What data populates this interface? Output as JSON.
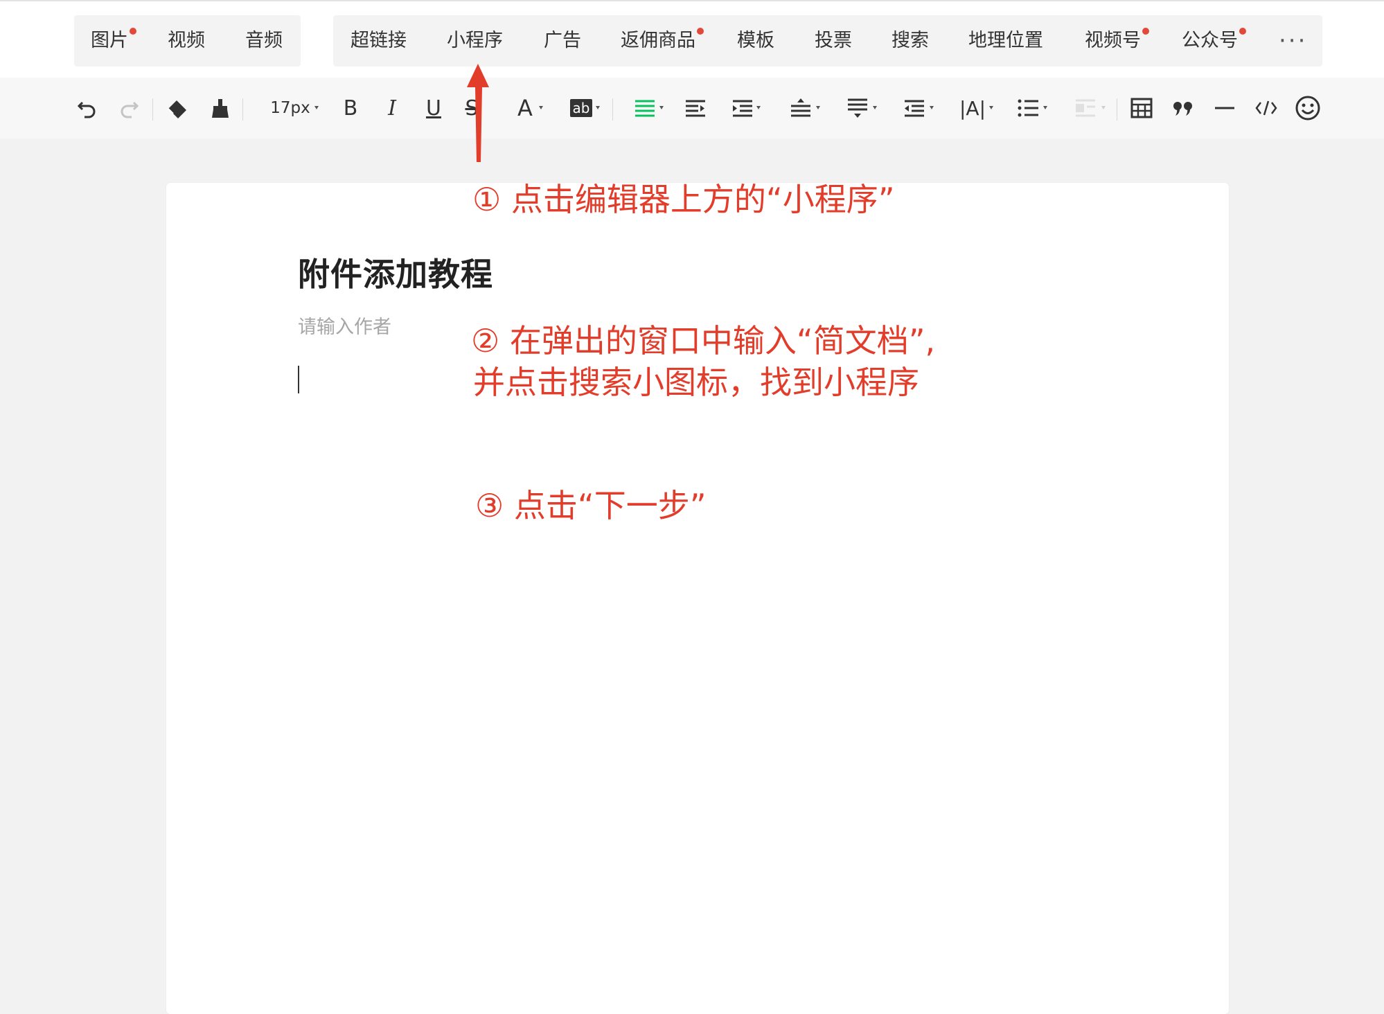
{
  "insert_bar": {
    "group1": [
      {
        "label": "图片",
        "dot": true
      },
      {
        "label": "视频",
        "dot": false
      },
      {
        "label": "音频",
        "dot": false
      }
    ],
    "group2": [
      {
        "label": "超链接",
        "dot": false
      },
      {
        "label": "小程序",
        "dot": false
      },
      {
        "label": "广告",
        "dot": false
      },
      {
        "label": "返佣商品",
        "dot": true
      },
      {
        "label": "模板",
        "dot": false
      },
      {
        "label": "投票",
        "dot": false
      },
      {
        "label": "搜索",
        "dot": false
      },
      {
        "label": "地理位置",
        "dot": false
      },
      {
        "label": "视频号",
        "dot": true
      },
      {
        "label": "公众号",
        "dot": true
      }
    ],
    "more_label": "···"
  },
  "toolbar": {
    "font_size": "17px",
    "bold_label": "B",
    "italic_label": "I",
    "underline_label": "U",
    "strike_label": "S",
    "font_color_label": "A",
    "bg_color_label": "ab",
    "letter_spacing_label": "|A|",
    "icons": [
      "undo-icon",
      "redo-icon",
      "clear-format-icon",
      "format-painter-icon",
      "align-icon",
      "indent-icon",
      "first-line-indent-icon",
      "line-height-icon",
      "paragraph-spacing-icon",
      "outdent-icon",
      "list-icon",
      "image-align-icon",
      "table-icon",
      "quote-icon",
      "divider-icon",
      "code-icon",
      "emoji-icon"
    ],
    "accent_color": "#07c160"
  },
  "document": {
    "title": "附件添加教程",
    "author_placeholder": "请输入作者"
  },
  "annotations": {
    "color": "#e23c2a",
    "step1": "① 点击编辑器上方的“小程序”",
    "step2_line1": "② 在弹出的窗口中输入“简文档”,",
    "step2_line2": "并点击搜索小图标，找到小程序",
    "step3": "③ 点击“下一步”"
  }
}
